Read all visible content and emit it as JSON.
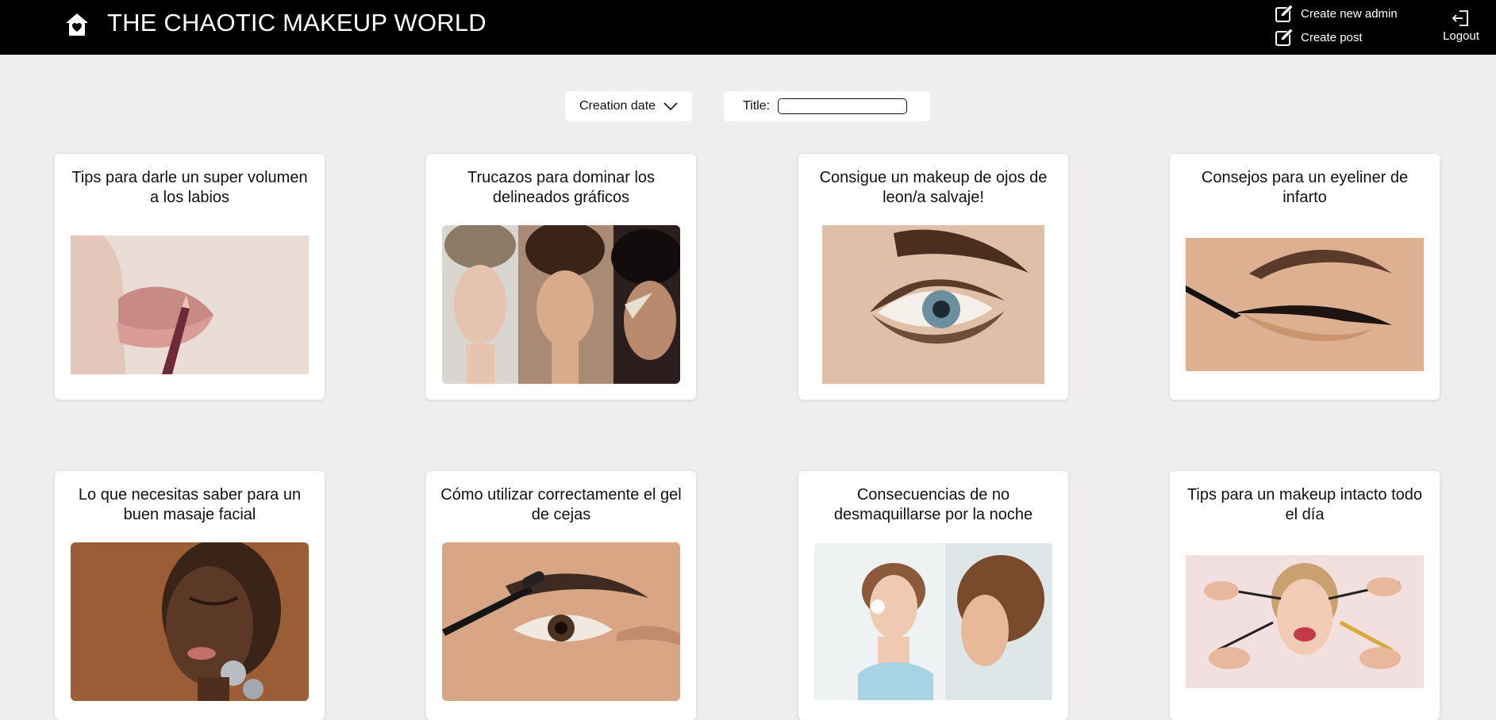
{
  "header": {
    "site_title": "THE CHAOTIC MAKEUP WORLD",
    "home_icon": "home-heart-icon",
    "actions": {
      "create_admin": "Create new admin",
      "create_post": "Create post",
      "logout": "Logout"
    }
  },
  "filters": {
    "sort_label": "Creation date",
    "title_label": "Title:",
    "title_value": ""
  },
  "posts": [
    {
      "title": "Tips para darle un super volumen a los labios",
      "image": "lips-liner-photo"
    },
    {
      "title": "Trucazos para dominar los delineados gráficos",
      "image": "graphic-liner-collage-photo"
    },
    {
      "title": "Consigue un makeup de ojos de leon/a salvaje!",
      "image": "smoky-eye-photo"
    },
    {
      "title": "Consejos para un eyeliner de infarto",
      "image": "winged-eyeliner-photo"
    },
    {
      "title": "Lo que necesitas saber para un buen masaje facial",
      "image": "face-roller-photo"
    },
    {
      "title": "Cómo utilizar correctamente el gel de cejas",
      "image": "brow-gel-photo"
    },
    {
      "title": "Consecuencias de no desmaquillarse por la noche",
      "image": "makeup-removal-photo"
    },
    {
      "title": "Tips para un makeup intacto todo el día",
      "image": "makeup-brushes-photo"
    }
  ]
}
